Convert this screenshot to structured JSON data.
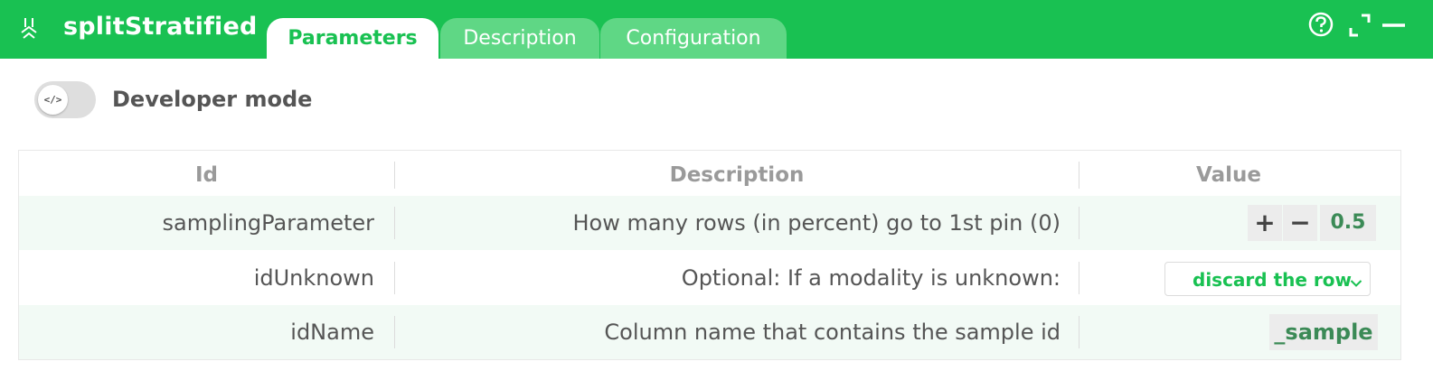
{
  "header": {
    "title": "splitStratified",
    "tabs": [
      {
        "label": "Parameters",
        "active": true
      },
      {
        "label": "Description",
        "active": false
      },
      {
        "label": "Configuration",
        "active": false
      }
    ],
    "icons": [
      "help-icon",
      "expand-icon",
      "minimize-icon"
    ]
  },
  "developer_mode": {
    "label": "Developer mode",
    "toggle_glyph": "</>",
    "enabled": false
  },
  "table": {
    "columns": [
      "Id",
      "Description",
      "Value"
    ],
    "rows": [
      {
        "id": "samplingParameter",
        "description": "How many rows (in percent) go to 1st pin (0)",
        "plus": "+",
        "minus": "−",
        "value": "0.5"
      },
      {
        "id": "idUnknown",
        "description": "Optional: If a modality is unknown:",
        "value": "discard the row"
      },
      {
        "id": "idName",
        "description": "Column name that contains the sample id",
        "value": "_sample"
      }
    ]
  },
  "colors": {
    "accent": "#19c152",
    "tab_inactive": "#5fd785",
    "value_text": "#3b8a56",
    "row_shade": "#f2faf5"
  }
}
